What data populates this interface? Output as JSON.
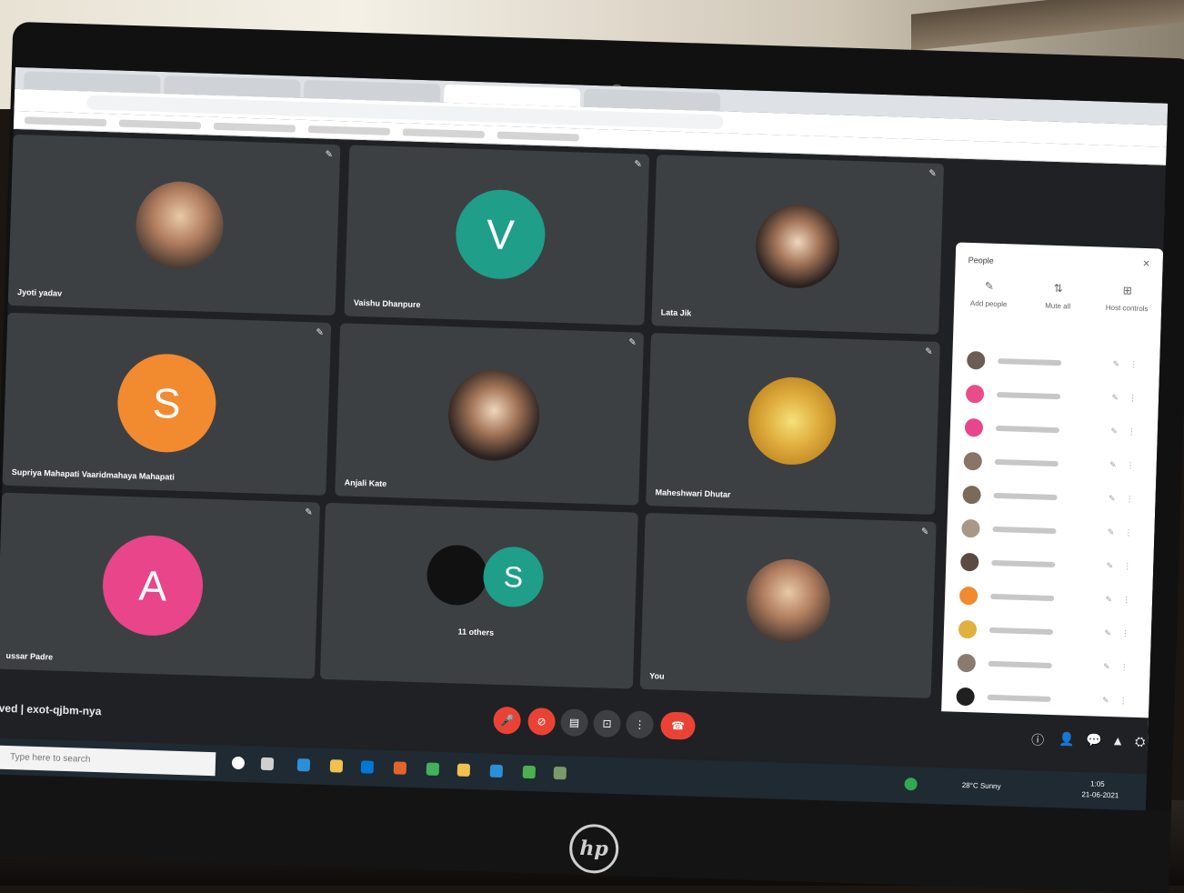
{
  "tiles": [
    {
      "name": "Jyoti yadav",
      "initial": "",
      "color": ""
    },
    {
      "name": "Vaishu Dhanpure",
      "initial": "V",
      "color": "#1f9e8a"
    },
    {
      "name": "Lata Jik",
      "initial": "",
      "color": ""
    },
    {
      "name": "Supriya Mahapati Vaaridmahaya Mahapati",
      "initial": "S",
      "color": "#f28a30"
    },
    {
      "name": "Anjali Kate",
      "initial": "",
      "color": ""
    },
    {
      "name": "Maheshwari Dhutar",
      "initial": "",
      "color": ""
    },
    {
      "name": "ussar Padre",
      "initial": "A",
      "color": "#e8458a"
    },
    {
      "name": "11 others",
      "initial": "S",
      "color": "#1f9e8a"
    },
    {
      "name": "You",
      "initial": "",
      "color": ""
    }
  ],
  "panel": {
    "title": "People",
    "close": "✕",
    "actions": [
      {
        "icon": "✎",
        "label": "Add people"
      },
      {
        "icon": "⇅",
        "label": "Mute all"
      },
      {
        "icon": "⊞",
        "label": "Host controls"
      }
    ],
    "avatar_colors": [
      "#6b5c55",
      "#ea4c89",
      "#e8458a",
      "#8a7466",
      "#7a6a5a",
      "#a89888",
      "#5a4a42",
      "#f28a30",
      "#e0b040",
      "#8a7a70",
      "#202020",
      "#1f9e8a"
    ]
  },
  "controls": {
    "meeting_code": "ved | exot-qjbm-nya",
    "buttons": [
      "🎤",
      "⊘",
      "▤",
      "⊡",
      "⋮",
      "☎"
    ],
    "right_icons": [
      "ⓘ",
      "👤",
      "💬",
      "▲",
      "⛭"
    ]
  },
  "taskbar": {
    "search_placeholder": "Type here to search",
    "weather": "28°C Sunny",
    "time": "1:05",
    "date": "21-06-2021"
  },
  "brand": "hp"
}
